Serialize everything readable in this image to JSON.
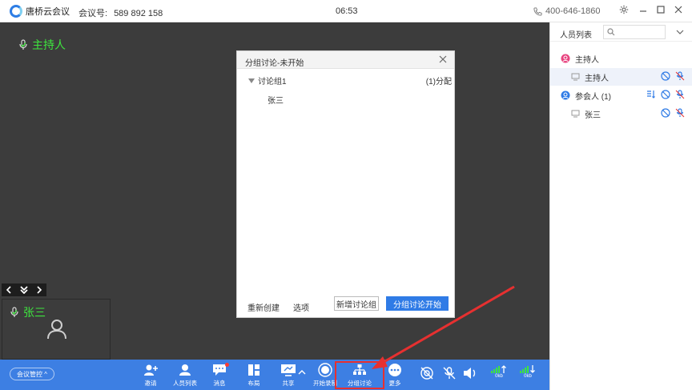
{
  "titlebar": {
    "app_name": "唐桥云会议",
    "meeting_label": "会议号:",
    "meeting_number": "589 892 158",
    "time": "06:53",
    "phone": "400-646-1860"
  },
  "video": {
    "host_label": "主持人",
    "participant_name": "张三"
  },
  "dialog": {
    "title": "分组讨论-未开始",
    "group_name": "讨论组1",
    "group_count": "(1)分配",
    "member": "张三",
    "recreate": "重新创建",
    "options": "选项",
    "add_group": "新增讨论组",
    "start": "分组讨论开始"
  },
  "panel": {
    "title": "人员列表",
    "host_section": "主持人",
    "host_name": "主持人",
    "participant_section": "参会人 (1)",
    "participant_name": "张三"
  },
  "toolbar": {
    "meeting_control": "会议管控 ^",
    "invite": "邀请",
    "members": "人员列表",
    "chat": "消息",
    "layout": "布局",
    "share": "共享",
    "record": "开始录制",
    "breakout": "分组讨论",
    "more": "更多",
    "upload": "0kb",
    "download": "0kb"
  },
  "colors": {
    "accent": "#3d7fe3",
    "primary_button": "#2f7be6",
    "video_bg": "#3c3c3c",
    "speaker_green": "#3ee63e",
    "annotation_red": "#e63030"
  }
}
